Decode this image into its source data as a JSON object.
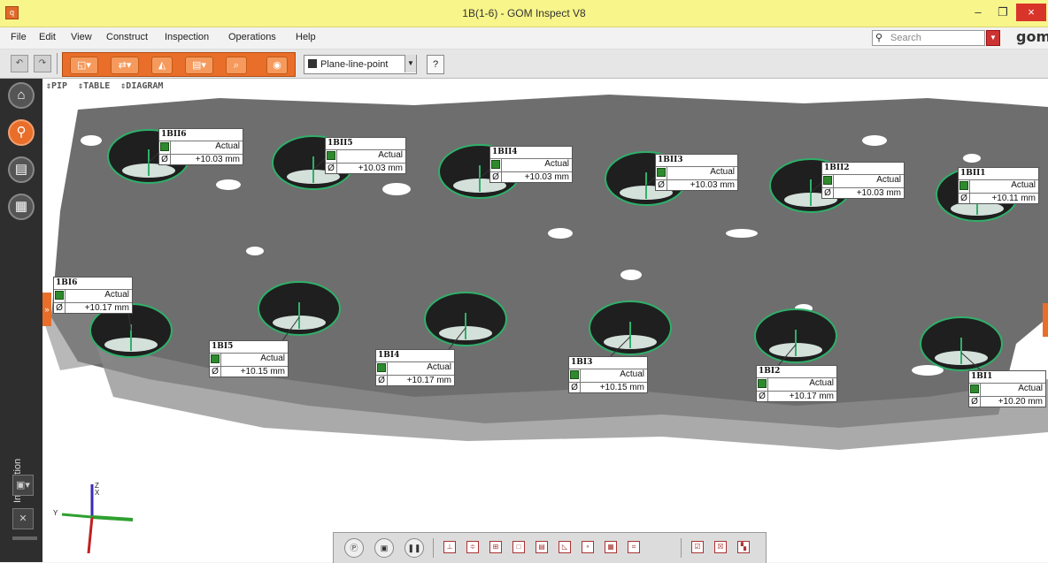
{
  "window": {
    "title": "1B(1-6) - GOM Inspect V8",
    "min": "–",
    "restore": "❐",
    "close": "×"
  },
  "menu": [
    "File",
    "Edit",
    "View",
    "Construct",
    "Inspection",
    "Operations",
    "Help"
  ],
  "search": {
    "placeholder": "Search",
    "icon": "search-icon"
  },
  "logo": "gom",
  "toolbar": {
    "alignment_value": "Plane-line-point",
    "help_label": "?"
  },
  "viewport_tabs": [
    "⇕PIP",
    "⇕TABLE",
    "⇕DIAGRAM"
  ],
  "sidebar": {
    "label": "Inspection",
    "buttons": [
      "home-icon",
      "search-icon",
      "document-icon",
      "grid-icon"
    ]
  },
  "measurements": [
    {
      "name": "1BII6",
      "status": "Actual",
      "symbol": "Ø",
      "value": "+10.03 mm"
    },
    {
      "name": "1BII5",
      "status": "Actual",
      "symbol": "Ø",
      "value": "+10.03 mm"
    },
    {
      "name": "1BII4",
      "status": "Actual",
      "symbol": "Ø",
      "value": "+10.03 mm"
    },
    {
      "name": "1BII3",
      "status": "Actual",
      "symbol": "Ø",
      "value": "+10.03 mm"
    },
    {
      "name": "1BII2",
      "status": "Actual",
      "symbol": "Ø",
      "value": "+10.03 mm"
    },
    {
      "name": "1BII1",
      "status": "Actual",
      "symbol": "Ø",
      "value": "+10.11 mm"
    },
    {
      "name": "1BI6",
      "status": "Actual",
      "symbol": "Ø",
      "value": "+10.17 mm"
    },
    {
      "name": "1BI5",
      "status": "Actual",
      "symbol": "Ø",
      "value": "+10.15 mm"
    },
    {
      "name": "1BI4",
      "status": "Actual",
      "symbol": "Ø",
      "value": "+10.17 mm"
    },
    {
      "name": "1BI3",
      "status": "Actual",
      "symbol": "Ø",
      "value": "+10.15 mm"
    },
    {
      "name": "1BI2",
      "status": "Actual",
      "symbol": "Ø",
      "value": "+10.17 mm"
    },
    {
      "name": "1BI1",
      "status": "Actual",
      "symbol": "Ø",
      "value": "+10.20 mm"
    }
  ],
  "axes": {
    "z": "Z",
    "x": "X",
    "y": "Y"
  },
  "colors": {
    "accent": "#e86e2a",
    "title_bar": "#f8f58a",
    "surface": "#6e6e6e",
    "hole_edge": "#2fb06a"
  }
}
